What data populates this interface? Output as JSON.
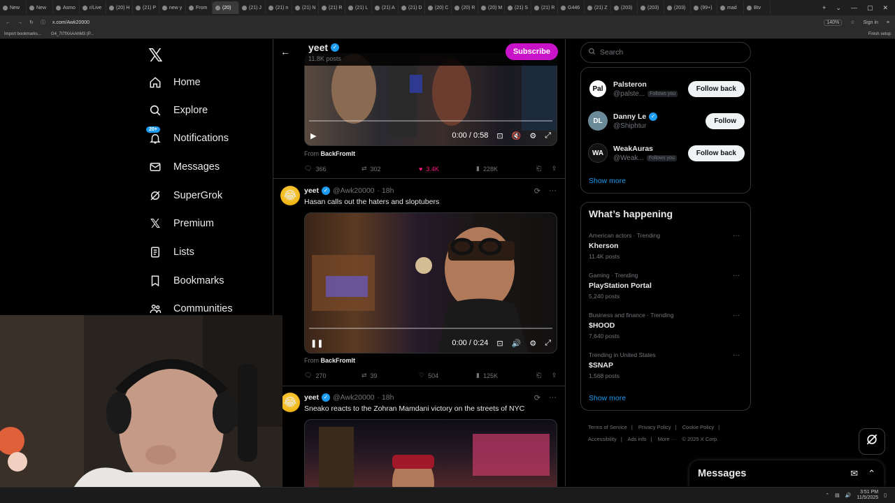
{
  "browser": {
    "tabs": [
      "New",
      "New",
      "Asmo",
      "r/Live",
      "(20) H",
      "(21) P",
      "new y",
      "From",
      "(20)",
      "(21) J",
      "(21) n",
      "(21) N",
      "(21) R",
      "(21) L",
      "(21) A",
      "(21) D",
      "(20) C",
      "(20) R",
      "(20) M",
      "(21) S",
      "(21) R",
      "G446",
      "(21) Z",
      "(203)",
      "(203)",
      "(203)",
      "(99+)",
      "mad",
      "Btv"
    ],
    "active_tab_index": 8,
    "url": "x.com/Awk20000",
    "zoom": "140%",
    "sign_in": "Sign in",
    "bookmarks": [
      "Import bookmarks...",
      "G4_7t7fXAAAhM3 (P..."
    ],
    "finish_setup": "Finish setup"
  },
  "nav": {
    "logo": "𝕏",
    "items": [
      {
        "label": "Home",
        "icon": "home-icon"
      },
      {
        "label": "Explore",
        "icon": "search-icon"
      },
      {
        "label": "Notifications",
        "icon": "bell-icon",
        "badge": "20+"
      },
      {
        "label": "Messages",
        "icon": "mail-icon"
      },
      {
        "label": "SuperGrok",
        "icon": "grok-icon"
      },
      {
        "label": "Premium",
        "icon": "x-icon"
      },
      {
        "label": "Lists",
        "icon": "list-icon"
      },
      {
        "label": "Bookmarks",
        "icon": "bookmark-icon"
      },
      {
        "label": "Communities",
        "icon": "people-icon"
      }
    ]
  },
  "profile_header": {
    "name": "yeet",
    "posts": "11.8K posts",
    "subscribe": "Subscribe"
  },
  "tweets": [
    {
      "video_time": "0:00 / 0:58",
      "from_prefix": "From",
      "from_source": "BackFromIt",
      "replies": "366",
      "reposts": "302",
      "likes": "3.4K",
      "liked": true,
      "views": "228K"
    },
    {
      "name": "yeet",
      "handle": "@Awk20000",
      "time": "· 18h",
      "text": "Hasan calls out the haters and sloptubers",
      "video_time": "0:00 / 0:24",
      "from_prefix": "From",
      "from_source": "BackFromIt",
      "replies": "270",
      "reposts": "39",
      "likes": "504",
      "views": "125K"
    },
    {
      "name": "yeet",
      "handle": "@Awk20000",
      "time": "· 18h",
      "text": "Sneako reacts to the Zohran Mamdani victory on the streets of NYC"
    }
  ],
  "sidebar": {
    "search_placeholder": "Search",
    "who_to_follow": [
      {
        "name": "Palsteron",
        "handle": "@palste...",
        "follows_you": "Follows you",
        "button": "Follow back",
        "verified": false
      },
      {
        "name": "Danny Le",
        "handle": "@Shiphtur",
        "follows_you": "",
        "button": "Follow",
        "verified": true
      },
      {
        "name": "WeakAuras",
        "handle": "@Weak...",
        "follows_you": "Follows you",
        "button": "Follow back",
        "verified": false
      }
    ],
    "show_more_1": "Show more",
    "whats_happening_title": "What’s happening",
    "trends": [
      {
        "category": "American actors · Trending",
        "title": "Kherson",
        "posts": "11.4K posts"
      },
      {
        "category": "Gaming · Trending",
        "title": "PlayStation Portal",
        "posts": "5,240 posts"
      },
      {
        "category": "Business and finance · Trending",
        "title": "$HOOD",
        "posts": "7,640 posts"
      },
      {
        "category": "Trending in United States",
        "title": "$SNAP",
        "posts": "1,568 posts"
      }
    ],
    "show_more_2": "Show more",
    "footer": [
      "Terms of Service",
      "|",
      "Privacy Policy",
      "|",
      "Cookie Policy",
      "|",
      "Accessibility",
      "|",
      "Ads info",
      "|",
      "More ···",
      "© 2025 X Corp."
    ]
  },
  "messages_drawer": {
    "title": "Messages"
  },
  "taskbar": {
    "time": "3:51 PM",
    "date": "11/5/2025"
  },
  "colors": {
    "accent": "#1d9bf0",
    "subscribe": "#c913c9",
    "like": "#f91880",
    "border": "#2f3336",
    "muted": "#71767b"
  }
}
